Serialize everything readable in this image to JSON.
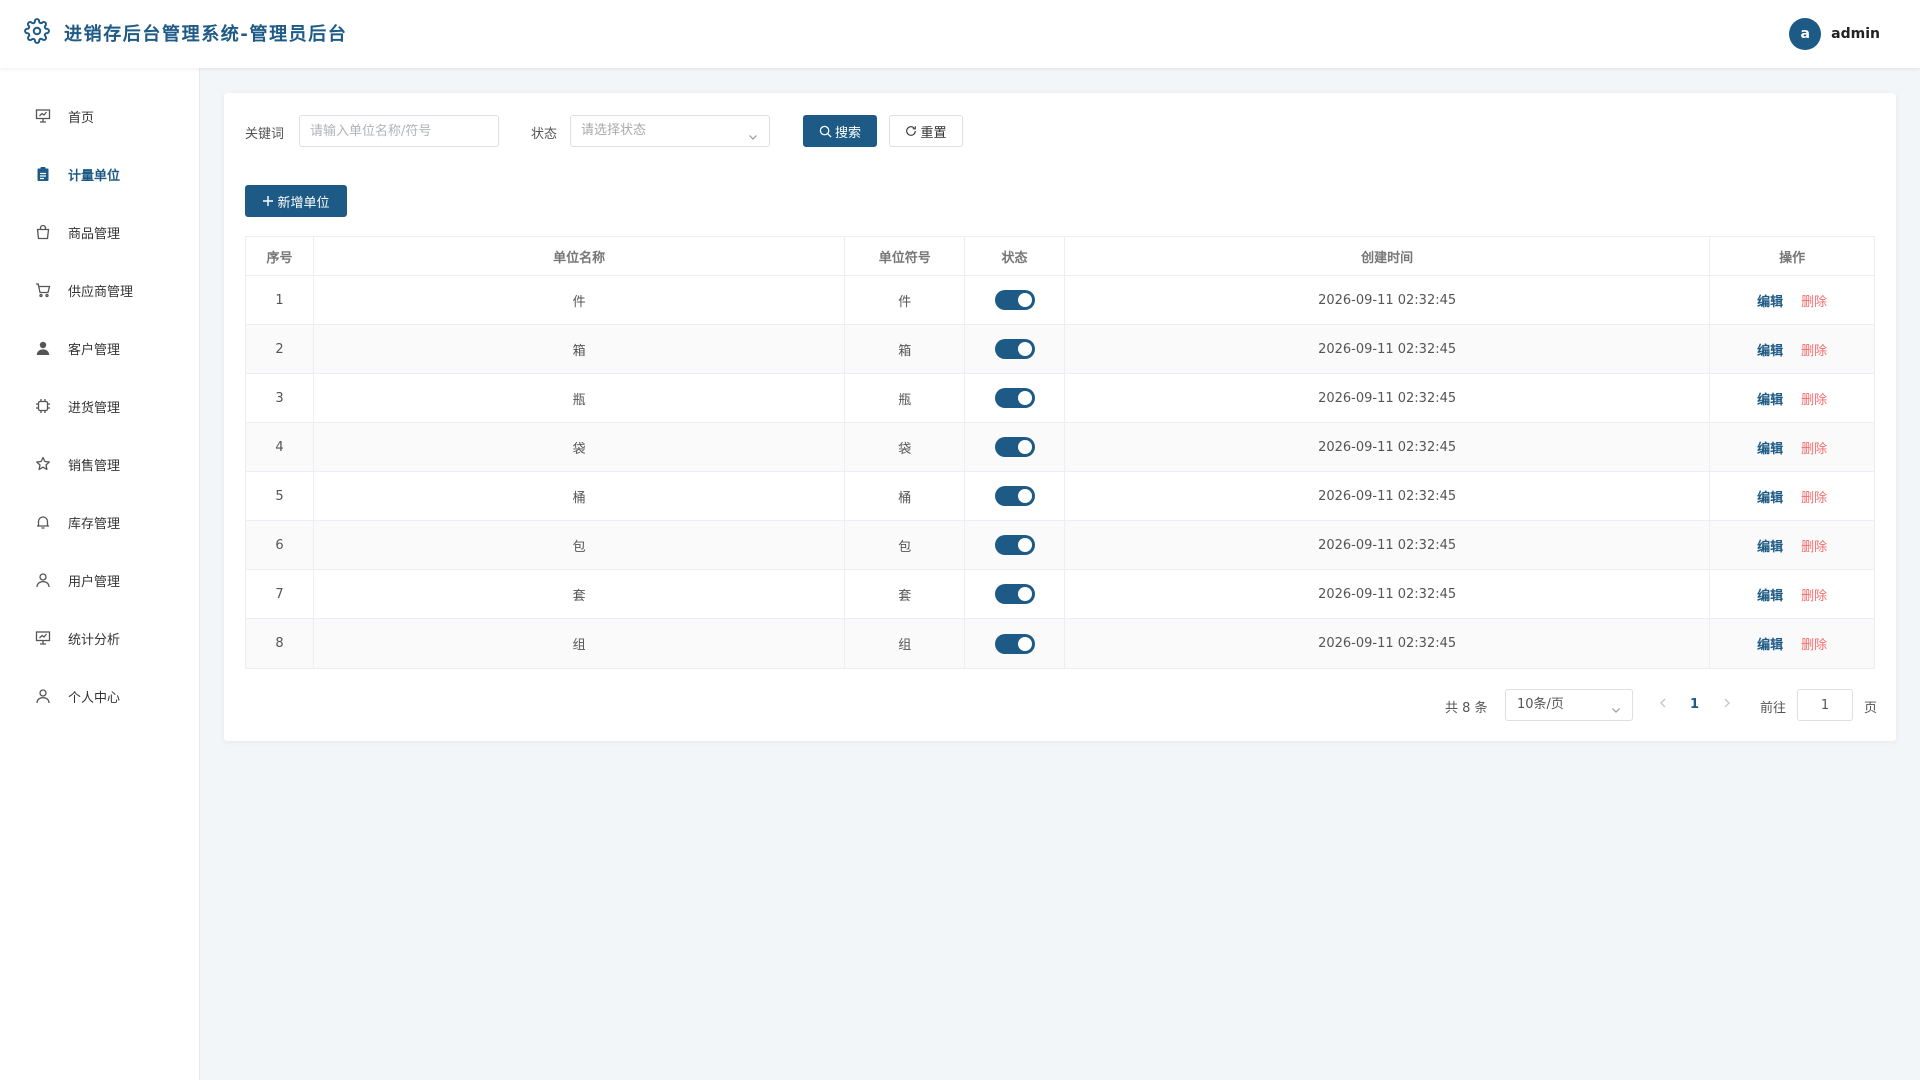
{
  "app": {
    "title": "进销存后台管理系统-管理员后台",
    "logo_icon": "gear-icon"
  },
  "user": {
    "avatar_letter": "a",
    "name": "admin"
  },
  "sidebar": {
    "items": [
      {
        "label": "首页",
        "icon": "presentation-icon",
        "active": false
      },
      {
        "label": "计量单位",
        "icon": "clipboard-icon",
        "active": true
      },
      {
        "label": "商品管理",
        "icon": "shopping-bag-icon",
        "active": false
      },
      {
        "label": "供应商管理",
        "icon": "cart-icon",
        "active": false
      },
      {
        "label": "客户管理",
        "icon": "user-filled-icon",
        "active": false
      },
      {
        "label": "进货管理",
        "icon": "cpu-icon",
        "active": false
      },
      {
        "label": "销售管理",
        "icon": "star-icon",
        "active": false
      },
      {
        "label": "库存管理",
        "icon": "bell-icon",
        "active": false
      },
      {
        "label": "用户管理",
        "icon": "user-icon",
        "active": false
      },
      {
        "label": "统计分析",
        "icon": "chart-board-icon",
        "active": false
      },
      {
        "label": "个人中心",
        "icon": "user-icon",
        "active": false
      }
    ]
  },
  "search": {
    "keyword_label": "关键词",
    "keyword_placeholder": "请输入单位名称/符号",
    "status_label": "状态",
    "status_placeholder": "请选择状态",
    "search_button": "搜索",
    "reset_button": "重置"
  },
  "toolbar": {
    "add_button": "新增单位"
  },
  "table": {
    "headers": [
      "序号",
      "单位名称",
      "单位符号",
      "状态",
      "创建时间",
      "操作"
    ],
    "rows": [
      {
        "index": "1",
        "name": "件",
        "symbol": "件",
        "enabled": true,
        "created": "2026-09-11 02:32:45"
      },
      {
        "index": "2",
        "name": "箱",
        "symbol": "箱",
        "enabled": true,
        "created": "2026-09-11 02:32:45"
      },
      {
        "index": "3",
        "name": "瓶",
        "symbol": "瓶",
        "enabled": true,
        "created": "2026-09-11 02:32:45"
      },
      {
        "index": "4",
        "name": "袋",
        "symbol": "袋",
        "enabled": true,
        "created": "2026-09-11 02:32:45"
      },
      {
        "index": "5",
        "name": "桶",
        "symbol": "桶",
        "enabled": true,
        "created": "2026-09-11 02:32:45"
      },
      {
        "index": "6",
        "name": "包",
        "symbol": "包",
        "enabled": true,
        "created": "2026-09-11 02:32:45"
      },
      {
        "index": "7",
        "name": "套",
        "symbol": "套",
        "enabled": true,
        "created": "2026-09-11 02:32:45"
      },
      {
        "index": "8",
        "name": "组",
        "symbol": "组",
        "enabled": true,
        "created": "2026-09-11 02:32:45"
      }
    ],
    "edit_label": "编辑",
    "delete_label": "删除"
  },
  "pagination": {
    "total_text": "共 8 条",
    "page_size": "10条/页",
    "current_page": "1",
    "goto_label": "前往",
    "goto_value": "1",
    "page_unit": "页"
  },
  "colors": {
    "primary": "#1d5a85",
    "danger": "#f56c6c",
    "background": "#f3f6f9"
  }
}
